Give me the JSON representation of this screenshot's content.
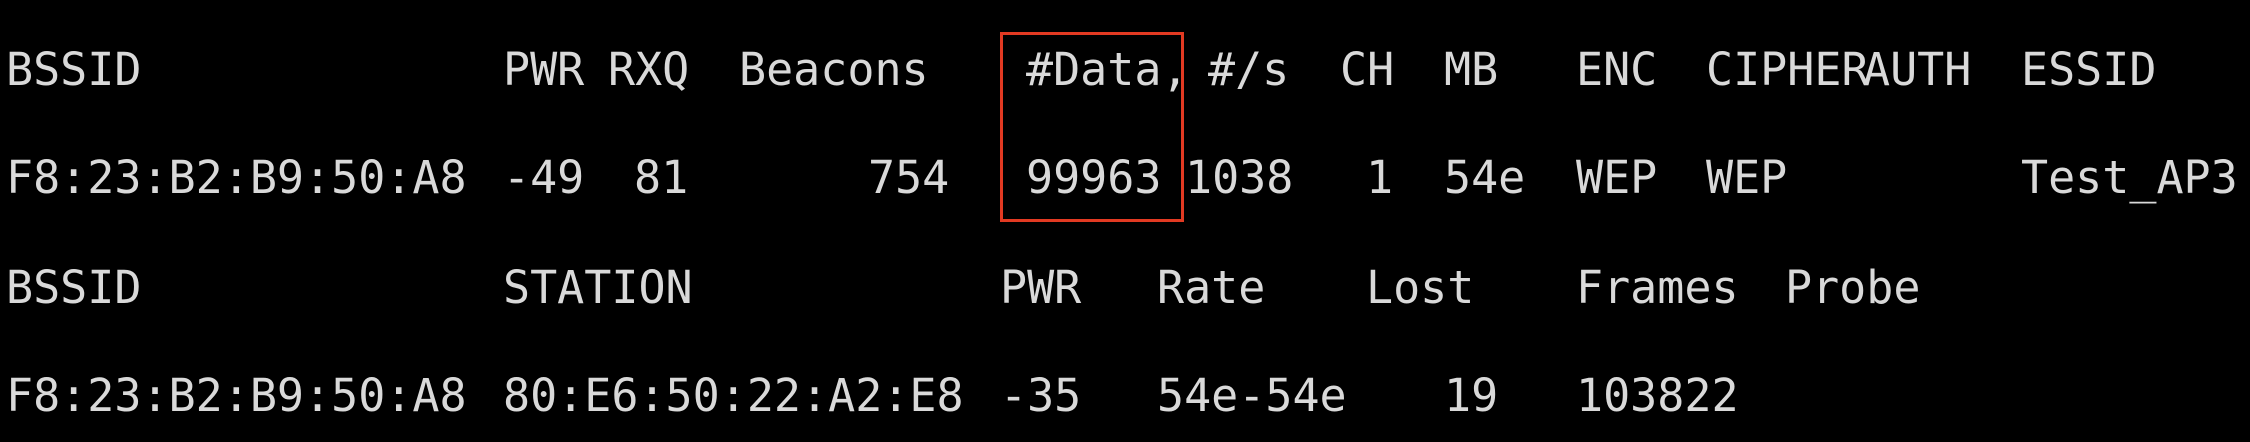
{
  "colors": {
    "background": "#000000",
    "text": "#d9d9d9",
    "highlight_border": "#e23a22"
  },
  "ap_header": {
    "bssid": "BSSID",
    "pwr": "PWR",
    "rxq": "RXQ",
    "beacons": "Beacons",
    "data": "#Data,",
    "per_sec": "#/s",
    "ch": "CH",
    "mb": "MB",
    "enc": "ENC",
    "cipher": "CIPHER",
    "auth": "AUTH",
    "essid": "ESSID"
  },
  "ap_row": {
    "bssid": "F8:23:B2:B9:50:A8",
    "pwr": "-49",
    "rxq": "81",
    "beacons": "754",
    "data": "99963",
    "per_sec": "1038",
    "ch": "1",
    "mb": "54e",
    "enc": "WEP",
    "cipher": "WEP",
    "auth": "",
    "essid": "Test_AP3"
  },
  "station_header": {
    "bssid": "BSSID",
    "station": "STATION",
    "pwr": "PWR",
    "rate": "Rate",
    "lost": "Lost",
    "frames": "Frames",
    "probe": "Probe"
  },
  "station_row": {
    "bssid": "F8:23:B2:B9:50:A8",
    "station": "80:E6:50:22:A2:E8",
    "pwr": "-35",
    "rate": "54e-54e",
    "lost": "19",
    "frames": "103822",
    "probe": ""
  }
}
